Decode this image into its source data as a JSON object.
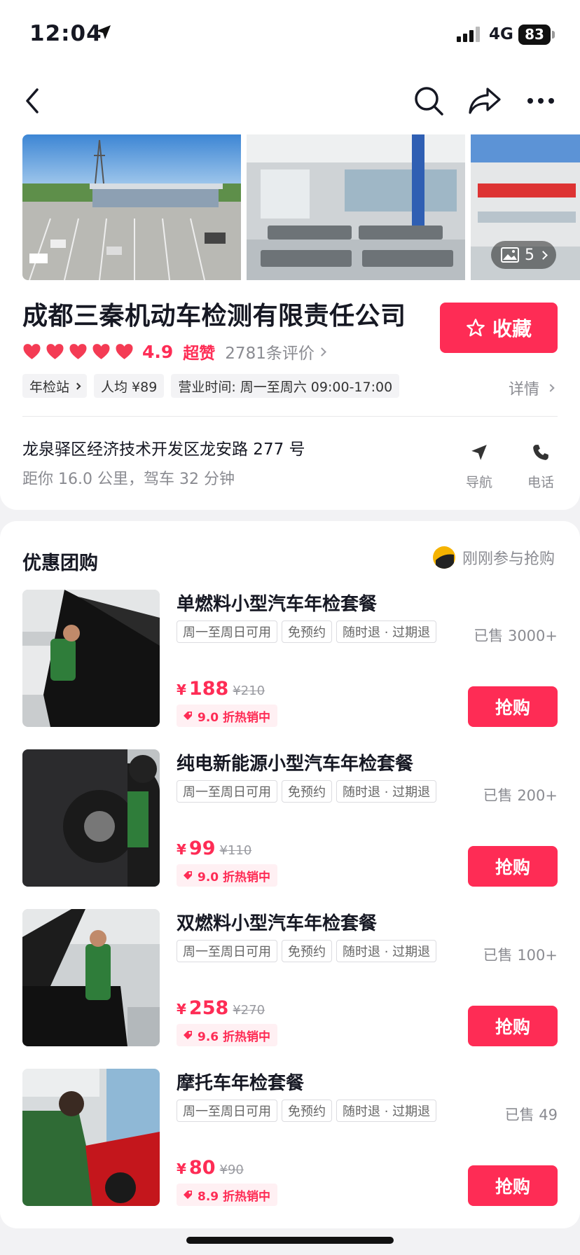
{
  "status": {
    "time": "12:04",
    "network": "4G",
    "battery": "83"
  },
  "gallery": {
    "photo_count": "5"
  },
  "shop": {
    "name": "成都三秦机动车检测有限责任公司",
    "favorite_label": "收藏",
    "rating": "4.9",
    "rating_word": "超赞",
    "reviews": "2781条评价",
    "tags": [
      "年检站",
      "人均 ¥89",
      "营业时间: 周一至周六 09:00-17:00"
    ],
    "detail_label": "详情",
    "address": "龙泉驿区经济技术开发区龙安路 277 号",
    "distance": "距你 16.0 公里，驾车 32 分钟",
    "nav_label": "导航",
    "call_label": "电话"
  },
  "deals": {
    "title": "优惠团购",
    "live_text": "刚刚参与抢购",
    "items": [
      {
        "name": "单燃料小型汽车年检套餐",
        "tags": [
          "周一至周日可用",
          "免预约",
          "随时退 · 过期退"
        ],
        "sold": "已售 3000+",
        "price": "188",
        "original": "¥210",
        "discount": "9.0 折热销中",
        "buy": "抢购"
      },
      {
        "name": "纯电新能源小型汽车年检套餐",
        "tags": [
          "周一至周日可用",
          "免预约",
          "随时退 · 过期退"
        ],
        "sold": "已售 200+",
        "price": "99",
        "original": "¥110",
        "discount": "9.0 折热销中",
        "buy": "抢购"
      },
      {
        "name": "双燃料小型汽车年检套餐",
        "tags": [
          "周一至周日可用",
          "免预约",
          "随时退 · 过期退"
        ],
        "sold": "已售 100+",
        "price": "258",
        "original": "¥270",
        "discount": "9.6 折热销中",
        "buy": "抢购"
      },
      {
        "name": "摩托车年检套餐",
        "tags": [
          "周一至周日可用",
          "免预约",
          "随时退 · 过期退"
        ],
        "sold": "已售 49",
        "price": "80",
        "original": "¥90",
        "discount": "8.9 折热销中",
        "buy": "抢购"
      }
    ],
    "currency": "¥"
  },
  "colors": {
    "accent": "#fe2c55",
    "muted": "#8a8b91"
  }
}
